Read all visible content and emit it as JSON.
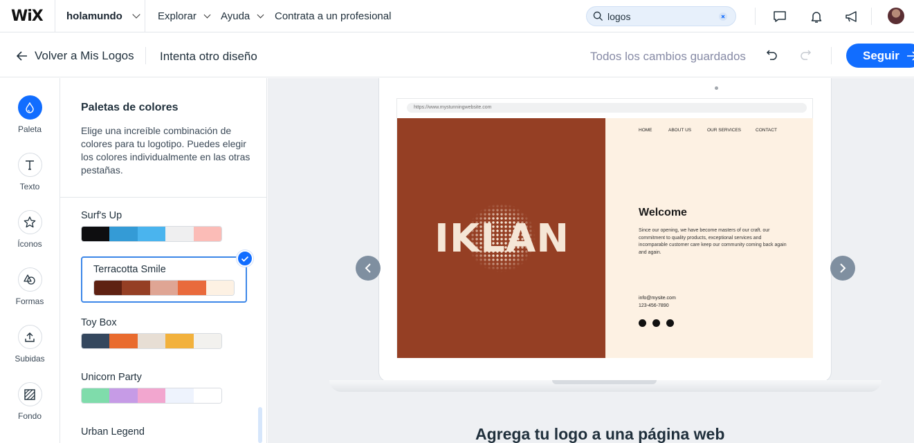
{
  "topbar": {
    "logo": "WiX",
    "site_name": "holamundo",
    "nav": [
      "Explorar",
      "Ayuda",
      "Contrata a un profesional"
    ],
    "search_value": "logos"
  },
  "subbar": {
    "back_label": "Volver a Mis Logos",
    "try_other_label": "Intenta otro diseño",
    "saved_status": "Todos los cambios guardados",
    "next_label": "Seguir"
  },
  "rail": {
    "items": [
      {
        "label": "Paleta",
        "icon": "drop-icon"
      },
      {
        "label": "Texto",
        "icon": "text-icon"
      },
      {
        "label": "Íconos",
        "icon": "star-icon"
      },
      {
        "label": "Formas",
        "icon": "shapes-icon"
      },
      {
        "label": "Subidas",
        "icon": "upload-icon"
      },
      {
        "label": "Fondo",
        "icon": "background-icon"
      }
    ]
  },
  "panel": {
    "title": "Paletas de colores",
    "description": "Elige una increíble combinación de colores para tu logotipo. Puedes elegir los colores individualmente en las otras pestañas.",
    "palettes": [
      {
        "name": "Surf's Up",
        "colors": [
          "#0e0e10",
          "#349bd6",
          "#4ab4ee",
          "#efeff0",
          "#fbbcb7"
        ]
      },
      {
        "name": "Terracotta Smile",
        "colors": [
          "#5e2112",
          "#953f24",
          "#dfa594",
          "#e96a3c",
          "#fdf1e3"
        ],
        "selected": true
      },
      {
        "name": "Toy Box",
        "colors": [
          "#34475e",
          "#e96b2e",
          "#e7ded4",
          "#f2b13c",
          "#f2f1ee"
        ]
      },
      {
        "name": "Unicorn Party",
        "colors": [
          "#7fdcab",
          "#c69be6",
          "#f2a6cf",
          "#eef3fd",
          "#ffffff"
        ]
      },
      {
        "name": "Urban Legend",
        "colors": []
      }
    ]
  },
  "preview": {
    "url": "https://www.mystunningwebsite.com",
    "brand": "IKLAN",
    "nav": [
      "HOME",
      "ABOUT US",
      "OUR SERVICES",
      "CONTACT"
    ],
    "welcome_title": "Welcome",
    "welcome_body": "Since our opening, we have become masters of our craft. our commitment to quality products, exceptional services and incomparable customer care keep our community coming back again and again.",
    "email": "info@mysite.com",
    "phone": "123-456-7890",
    "caption": "Agrega tu logo a una página web"
  },
  "colors": {
    "accent": "#116dff",
    "terracotta": "#953f24",
    "cream": "#fdf1e3"
  }
}
